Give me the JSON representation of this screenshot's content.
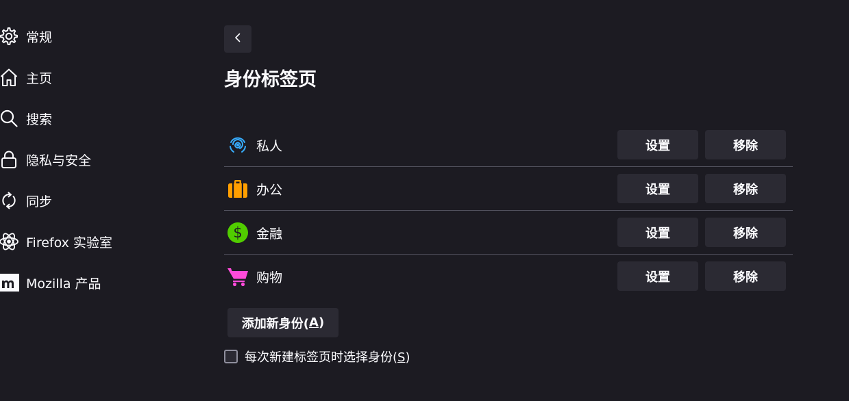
{
  "sidebar": {
    "items": [
      {
        "label": "常规",
        "icon": "gear-icon"
      },
      {
        "label": "主页",
        "icon": "home-icon"
      },
      {
        "label": "搜索",
        "icon": "search-icon"
      },
      {
        "label": "隐私与安全",
        "icon": "lock-icon"
      },
      {
        "label": "同步",
        "icon": "sync-icon"
      },
      {
        "label": "Firefox 实验室",
        "icon": "atom-icon"
      },
      {
        "label": "Mozilla 产品",
        "icon": "mozilla-icon"
      }
    ]
  },
  "main": {
    "back_icon": "chevron-left-icon",
    "title": "身份标签页",
    "containers": [
      {
        "name": "私人",
        "icon": "fingerprint-icon",
        "color": "#37adff",
        "settings_label": "设置",
        "remove_label": "移除"
      },
      {
        "name": "办公",
        "icon": "briefcase-icon",
        "color": "#ff9f00",
        "settings_label": "设置",
        "remove_label": "移除"
      },
      {
        "name": "金融",
        "icon": "dollar-icon",
        "color": "#51cd00",
        "settings_label": "设置",
        "remove_label": "移除"
      },
      {
        "name": "购物",
        "icon": "cart-icon",
        "color": "#ff4bda",
        "settings_label": "设置",
        "remove_label": "移除"
      }
    ],
    "add_button": {
      "label_prefix": "添加新身份(",
      "access_key": "A",
      "label_suffix": ")"
    },
    "checkbox": {
      "label_prefix": "每次新建标签页时选择身份(",
      "access_key": "S",
      "label_suffix": ")",
      "checked": false
    }
  }
}
